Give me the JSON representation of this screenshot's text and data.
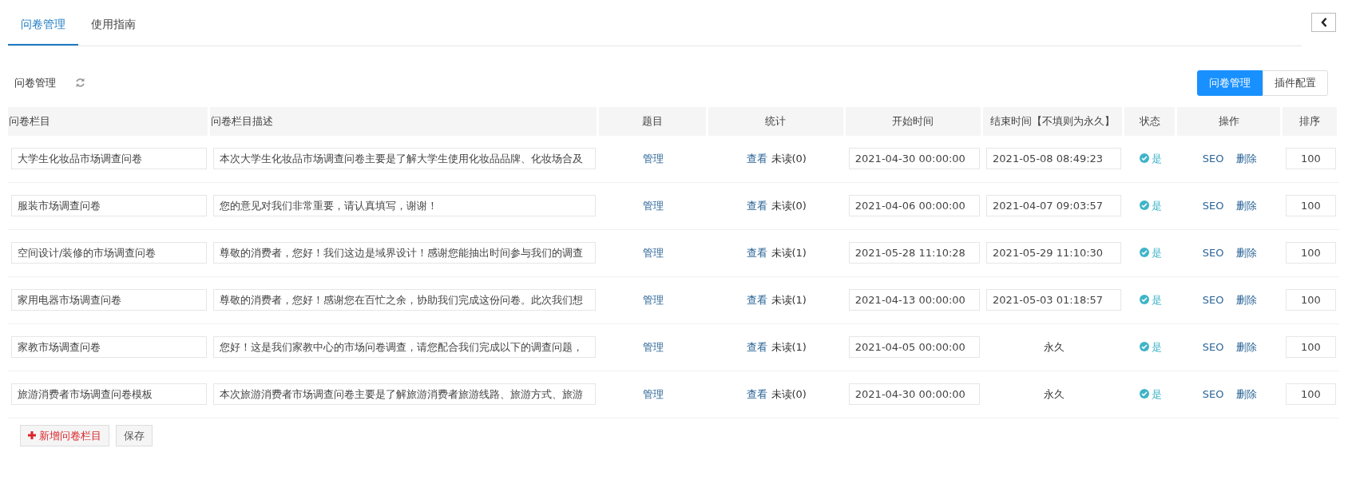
{
  "tabs": [
    {
      "label": "问卷管理",
      "selected": true
    },
    {
      "label": "使用指南",
      "selected": false
    }
  ],
  "panel_title": "问卷管理",
  "view_switch": [
    {
      "label": "问卷管理",
      "selected": true
    },
    {
      "label": "插件配置",
      "selected": false
    }
  ],
  "table": {
    "columns": [
      "问卷栏目",
      "问卷栏目描述",
      "题目",
      "统计",
      "开始时间",
      "结束时间【不填则为永久】",
      "状态",
      "操作",
      "排序"
    ],
    "rows": [
      {
        "name": "大学生化妆品市场调查问卷",
        "description": "本次大学生化妆品市场调查问卷主要是了解大学生使用化妆品品牌、化妆场合及",
        "manage": "管理",
        "view": "查看",
        "unread": "未读(0)",
        "start": "2021-04-30 00:00:00",
        "end": {
          "kind": "input",
          "text": "2021-05-08 08:49:23"
        },
        "status": {
          "on": true,
          "label": "是"
        },
        "actions": [
          "SEO",
          "删除"
        ],
        "order": "100"
      },
      {
        "name": "服装市场调查问卷",
        "description": "您的意见对我们非常重要，请认真填写，谢谢！",
        "manage": "管理",
        "view": "查看",
        "unread": "未读(0)",
        "start": "2021-04-06 00:00:00",
        "end": {
          "kind": "input",
          "text": "2021-04-07 09:03:57"
        },
        "status": {
          "on": true,
          "label": "是"
        },
        "actions": [
          "SEO",
          "删除"
        ],
        "order": "100"
      },
      {
        "name": "空间设计/装修的市场调查问卷",
        "description": "尊敬的消费者，您好！我们这边是域界设计！感谢您能抽出时间参与我们的调查",
        "manage": "管理",
        "view": "查看",
        "unread": "未读(1)",
        "start": "2021-05-28 11:10:28",
        "end": {
          "kind": "input",
          "text": "2021-05-29 11:10:30"
        },
        "status": {
          "on": true,
          "label": "是"
        },
        "actions": [
          "SEO",
          "删除"
        ],
        "order": "100"
      },
      {
        "name": "家用电器市场调查问卷",
        "description": "尊敬的消费者，您好！感谢您在百忙之余，协助我们完成这份问卷。此次我们想",
        "manage": "管理",
        "view": "查看",
        "unread": "未读(1)",
        "start": "2021-04-13 00:00:00",
        "end": {
          "kind": "input",
          "text": "2021-05-03 01:18:57"
        },
        "status": {
          "on": true,
          "label": "是"
        },
        "actions": [
          "SEO",
          "删除"
        ],
        "order": "100"
      },
      {
        "name": "家教市场调查问卷",
        "description": "您好！这是我们家教中心的市场问卷调查，请您配合我们完成以下的调查问题，",
        "manage": "管理",
        "view": "查看",
        "unread": "未读(1)",
        "start": "2021-04-05 00:00:00",
        "end": {
          "kind": "text",
          "text": "永久"
        },
        "status": {
          "on": true,
          "label": "是"
        },
        "actions": [
          "SEO",
          "删除"
        ],
        "order": "100"
      },
      {
        "name": "旅游消费者市场调查问卷模板",
        "description": "本次旅游消费者市场调查问卷主要是了解旅游消费者旅游线路、旅游方式、旅游",
        "manage": "管理",
        "view": "查看",
        "unread": "未读(0)",
        "start": "2021-04-30 00:00:00",
        "end": {
          "kind": "text",
          "text": "永久"
        },
        "status": {
          "on": true,
          "label": "是"
        },
        "actions": [
          "SEO",
          "删除"
        ],
        "order": "100"
      }
    ]
  },
  "buttons": [
    {
      "kind": "add",
      "label": "新增问卷栏目"
    },
    {
      "kind": "plain",
      "label": "保存"
    }
  ]
}
